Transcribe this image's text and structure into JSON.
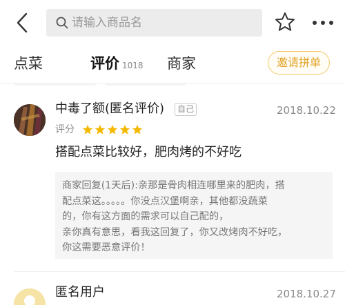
{
  "header": {
    "search_placeholder": "请输入商品名"
  },
  "tabs": [
    {
      "label": "点菜"
    },
    {
      "label": "评价",
      "count": "1018"
    },
    {
      "label": "商家"
    }
  ],
  "invite_button": "邀请拼单",
  "colors": {
    "accent": "#f5b800",
    "invite_border": "#f3c86a",
    "invite_text": "#e0a020",
    "reply_bg": "#f5f5f5"
  },
  "reviews": [
    {
      "name": "中毒了额(匿名评价)",
      "self_tag": "自己",
      "date": "2018.10.22",
      "score_label": "评分",
      "stars": 5,
      "text": "搭配点菜比较好，肥肉烤的不好吃",
      "reply_lines": [
        "商家回复(1天后):亲那是骨肉相连哪里来的肥肉，搭",
        "配点菜这。。。。。你没点汉堡啊亲，其他都没蔬菜",
        "的，你有这方面的需求可以自己配的，",
        "亲你真有意思，看我这回复了，你又改烤肉不好吃，",
        "你这需要恶意评价！"
      ]
    },
    {
      "name": "匿名用户",
      "date": "2018.10.27"
    }
  ],
  "icons": {
    "back": "back-arrow-icon",
    "search": "search-icon",
    "favorite": "star-outline-icon",
    "more": "more-dots-icon"
  }
}
